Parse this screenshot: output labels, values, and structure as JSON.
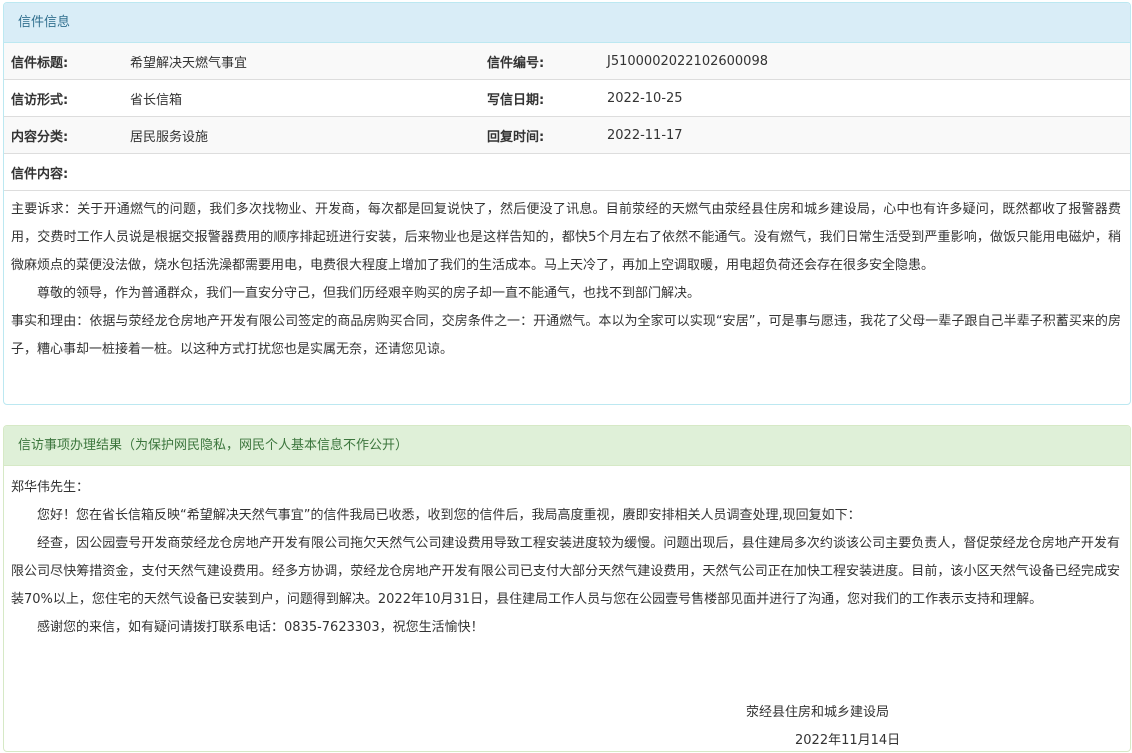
{
  "letter_panel": {
    "heading": "信件信息",
    "rows": [
      {
        "k1": "信件标题:",
        "v1": "希望解决天燃气事宜",
        "k2": "信件编号:",
        "v2": "J5100002022102600098"
      },
      {
        "k1": "信访形式:",
        "v1": "省长信箱",
        "k2": "写信日期:",
        "v2": "2022-10-25"
      },
      {
        "k1": "内容分类:",
        "v1": "居民服务设施",
        "k2": "回复时间:",
        "v2": "2022-11-17"
      }
    ],
    "content_label": "信件内容:",
    "content_paragraphs": [
      "主要诉求：关于开通燃气的问题，我们多次找物业、开发商，每次都是回复说快了，然后便没了讯息。目前荥经的天燃气由荥经县住房和城乡建设局，心中也有许多疑问，既然都收了报警器费用，交费时工作人员说是根据交报警器费用的顺序排起班进行安装，后来物业也是这样告知的，都快5个月左右了依然不能通气。没有燃气，我们日常生活受到严重影响，做饭只能用电磁炉，稍微麻烦点的菜便没法做，烧水包括洗澡都需要用电，电费很大程度上增加了我们的生活成本。马上天冷了，再加上空调取暖，用电超负荷还会存在很多安全隐患。",
      "尊敬的领导，作为普通群众，我们一直安分守己，但我们历经艰辛购买的房子却一直不能通气，也找不到部门解决。",
      "事实和理由：依据与荥经龙仓房地产开发有限公司签定的商品房购买合同，交房条件之一：开通燃气。本以为全家可以实现“安居”，可是事与愿违，我花了父母一辈子跟自己半辈子积蓄买来的房子，糟心事却一桩接着一桩。以这种方式打扰您也是实属无奈，还请您见谅。"
    ]
  },
  "result_panel": {
    "heading": "信访事项办理结果（为保护网民隐私，网民个人基本信息不作公开）",
    "salutation": "郑华伟先生：",
    "paragraphs": [
      "您好！您在省长信箱反映“希望解决天然气事宜”的信件我局已收悉，收到您的信件后，我局高度重视，赓即安排相关人员调查处理,现回复如下：",
      "经查，因公园壹号开发商荥经龙仓房地产开发有限公司拖欠天然气公司建设费用导致工程安装进度较为缓慢。问题出现后，县住建局多次约谈该公司主要负责人，督促荥经龙仓房地产开发有限公司尽快筹措资金，支付天然气建设费用。经多方协调，荥经龙仓房地产开发有限公司已支付大部分天然气建设费用，天然气公司正在加快工程安装进度。目前，该小区天然气设备已经完成安装70%以上，您住宅的天然气设备已安装到户，问题得到解决。2022年10月31日，县住建局工作人员与您在公园壹号售楼部见面并进行了沟通，您对我们的工作表示支持和理解。",
      "感谢您的来信，如有疑问请拨打联系电话：0835-7623303，祝您生活愉快！"
    ],
    "signature_org": "荥经县住房和城乡建设局",
    "signature_date": "2022年11月14日"
  }
}
